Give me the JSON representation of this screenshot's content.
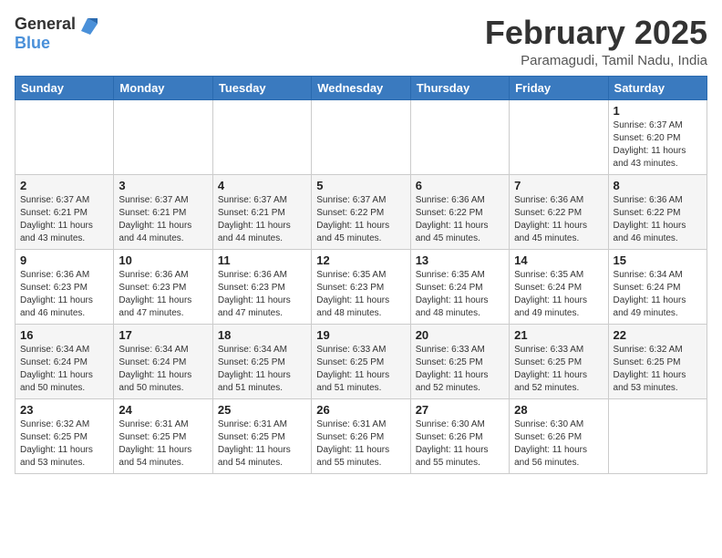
{
  "header": {
    "logo_line1": "General",
    "logo_line2": "Blue",
    "title": "February 2025",
    "subtitle": "Paramagudi, Tamil Nadu, India"
  },
  "weekdays": [
    "Sunday",
    "Monday",
    "Tuesday",
    "Wednesday",
    "Thursday",
    "Friday",
    "Saturday"
  ],
  "weeks": [
    [
      {
        "day": "",
        "info": ""
      },
      {
        "day": "",
        "info": ""
      },
      {
        "day": "",
        "info": ""
      },
      {
        "day": "",
        "info": ""
      },
      {
        "day": "",
        "info": ""
      },
      {
        "day": "",
        "info": ""
      },
      {
        "day": "1",
        "info": "Sunrise: 6:37 AM\nSunset: 6:20 PM\nDaylight: 11 hours\nand 43 minutes."
      }
    ],
    [
      {
        "day": "2",
        "info": "Sunrise: 6:37 AM\nSunset: 6:21 PM\nDaylight: 11 hours\nand 43 minutes."
      },
      {
        "day": "3",
        "info": "Sunrise: 6:37 AM\nSunset: 6:21 PM\nDaylight: 11 hours\nand 44 minutes."
      },
      {
        "day": "4",
        "info": "Sunrise: 6:37 AM\nSunset: 6:21 PM\nDaylight: 11 hours\nand 44 minutes."
      },
      {
        "day": "5",
        "info": "Sunrise: 6:37 AM\nSunset: 6:22 PM\nDaylight: 11 hours\nand 45 minutes."
      },
      {
        "day": "6",
        "info": "Sunrise: 6:36 AM\nSunset: 6:22 PM\nDaylight: 11 hours\nand 45 minutes."
      },
      {
        "day": "7",
        "info": "Sunrise: 6:36 AM\nSunset: 6:22 PM\nDaylight: 11 hours\nand 45 minutes."
      },
      {
        "day": "8",
        "info": "Sunrise: 6:36 AM\nSunset: 6:22 PM\nDaylight: 11 hours\nand 46 minutes."
      }
    ],
    [
      {
        "day": "9",
        "info": "Sunrise: 6:36 AM\nSunset: 6:23 PM\nDaylight: 11 hours\nand 46 minutes."
      },
      {
        "day": "10",
        "info": "Sunrise: 6:36 AM\nSunset: 6:23 PM\nDaylight: 11 hours\nand 47 minutes."
      },
      {
        "day": "11",
        "info": "Sunrise: 6:36 AM\nSunset: 6:23 PM\nDaylight: 11 hours\nand 47 minutes."
      },
      {
        "day": "12",
        "info": "Sunrise: 6:35 AM\nSunset: 6:23 PM\nDaylight: 11 hours\nand 48 minutes."
      },
      {
        "day": "13",
        "info": "Sunrise: 6:35 AM\nSunset: 6:24 PM\nDaylight: 11 hours\nand 48 minutes."
      },
      {
        "day": "14",
        "info": "Sunrise: 6:35 AM\nSunset: 6:24 PM\nDaylight: 11 hours\nand 49 minutes."
      },
      {
        "day": "15",
        "info": "Sunrise: 6:34 AM\nSunset: 6:24 PM\nDaylight: 11 hours\nand 49 minutes."
      }
    ],
    [
      {
        "day": "16",
        "info": "Sunrise: 6:34 AM\nSunset: 6:24 PM\nDaylight: 11 hours\nand 50 minutes."
      },
      {
        "day": "17",
        "info": "Sunrise: 6:34 AM\nSunset: 6:24 PM\nDaylight: 11 hours\nand 50 minutes."
      },
      {
        "day": "18",
        "info": "Sunrise: 6:34 AM\nSunset: 6:25 PM\nDaylight: 11 hours\nand 51 minutes."
      },
      {
        "day": "19",
        "info": "Sunrise: 6:33 AM\nSunset: 6:25 PM\nDaylight: 11 hours\nand 51 minutes."
      },
      {
        "day": "20",
        "info": "Sunrise: 6:33 AM\nSunset: 6:25 PM\nDaylight: 11 hours\nand 52 minutes."
      },
      {
        "day": "21",
        "info": "Sunrise: 6:33 AM\nSunset: 6:25 PM\nDaylight: 11 hours\nand 52 minutes."
      },
      {
        "day": "22",
        "info": "Sunrise: 6:32 AM\nSunset: 6:25 PM\nDaylight: 11 hours\nand 53 minutes."
      }
    ],
    [
      {
        "day": "23",
        "info": "Sunrise: 6:32 AM\nSunset: 6:25 PM\nDaylight: 11 hours\nand 53 minutes."
      },
      {
        "day": "24",
        "info": "Sunrise: 6:31 AM\nSunset: 6:25 PM\nDaylight: 11 hours\nand 54 minutes."
      },
      {
        "day": "25",
        "info": "Sunrise: 6:31 AM\nSunset: 6:25 PM\nDaylight: 11 hours\nand 54 minutes."
      },
      {
        "day": "26",
        "info": "Sunrise: 6:31 AM\nSunset: 6:26 PM\nDaylight: 11 hours\nand 55 minutes."
      },
      {
        "day": "27",
        "info": "Sunrise: 6:30 AM\nSunset: 6:26 PM\nDaylight: 11 hours\nand 55 minutes."
      },
      {
        "day": "28",
        "info": "Sunrise: 6:30 AM\nSunset: 6:26 PM\nDaylight: 11 hours\nand 56 minutes."
      },
      {
        "day": "",
        "info": ""
      }
    ]
  ]
}
